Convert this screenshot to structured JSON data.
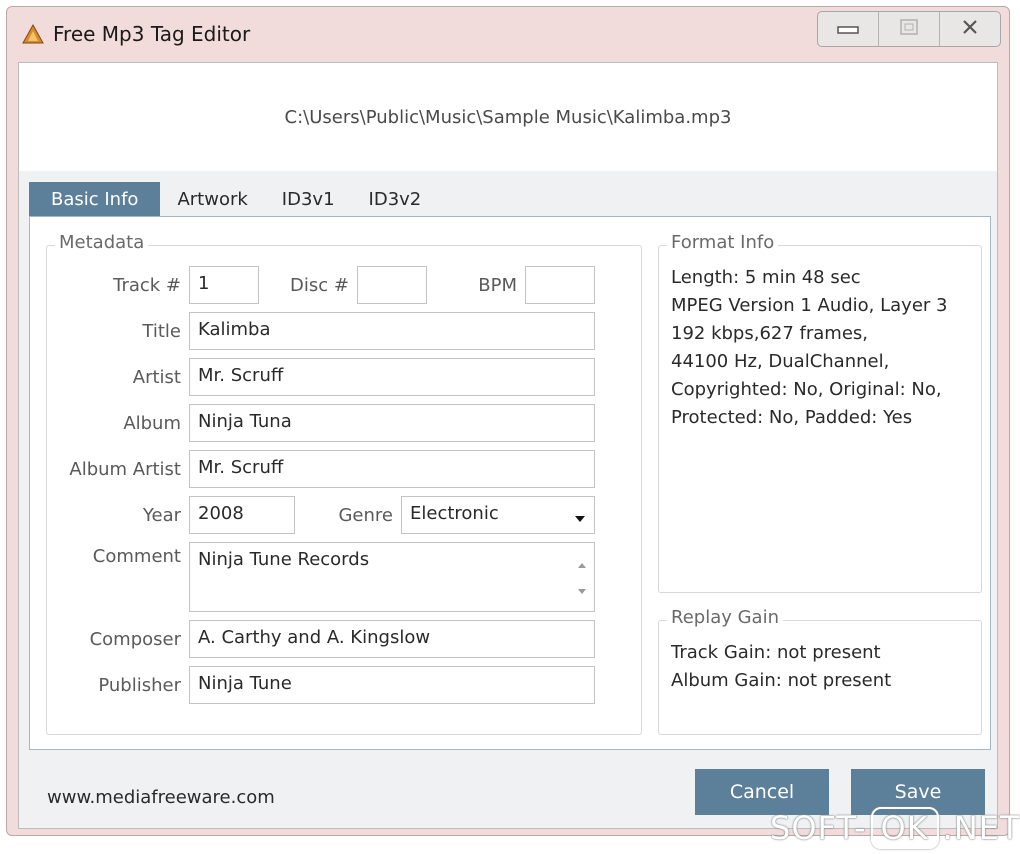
{
  "window": {
    "title": "Free Mp3 Tag Editor"
  },
  "file_path": "C:\\Users\\Public\\Music\\Sample Music\\Kalimba.mp3",
  "tabs": [
    {
      "label": "Basic Info",
      "active": true
    },
    {
      "label": "Artwork",
      "active": false
    },
    {
      "label": "ID3v1",
      "active": false
    },
    {
      "label": "ID3v2",
      "active": false
    }
  ],
  "metadata": {
    "group_title": "Metadata",
    "track": {
      "label": "Track #",
      "value": "1"
    },
    "disc": {
      "label": "Disc #",
      "value": ""
    },
    "bpm": {
      "label": "BPM",
      "value": ""
    },
    "title": {
      "label": "Title",
      "value": "Kalimba"
    },
    "artist": {
      "label": "Artist",
      "value": "Mr. Scruff"
    },
    "album": {
      "label": "Album",
      "value": "Ninja Tuna"
    },
    "album_artist": {
      "label": "Album Artist",
      "value": "Mr. Scruff"
    },
    "year": {
      "label": "Year",
      "value": "2008"
    },
    "genre": {
      "label": "Genre",
      "value": "Electronic"
    },
    "comment": {
      "label": "Comment",
      "value": "Ninja Tune Records"
    },
    "composer": {
      "label": "Composer",
      "value": "A. Carthy and A. Kingslow"
    },
    "publisher": {
      "label": "Publisher",
      "value": "Ninja Tune"
    }
  },
  "format_info": {
    "group_title": "Format Info",
    "lines": [
      "Length: 5 min 48 sec",
      "MPEG Version 1 Audio, Layer 3",
      "192 kbps,627 frames,",
      "44100 Hz, DualChannel,",
      "Copyrighted: No, Original: No,",
      "Protected: No, Padded: Yes"
    ]
  },
  "replay_gain": {
    "group_title": "Replay Gain",
    "lines": [
      "Track Gain: not present",
      "Album Gain: not present"
    ]
  },
  "footer": {
    "website": "www.mediafreeware.com",
    "cancel_label": "Cancel",
    "save_label": "Save"
  },
  "watermark": {
    "left": "SOFT-",
    "middle": "OK",
    "right": ".NET"
  },
  "colors": {
    "accent": "#5c7f9a",
    "window_frame": "#f1dcdb",
    "client_bg": "#eff1f3"
  },
  "icons": {
    "app": "mp3-file-icon",
    "minimize": "minimize-icon",
    "maximize": "maximize-icon",
    "close": "close-icon",
    "dropdown": "chevron-down-icon"
  }
}
